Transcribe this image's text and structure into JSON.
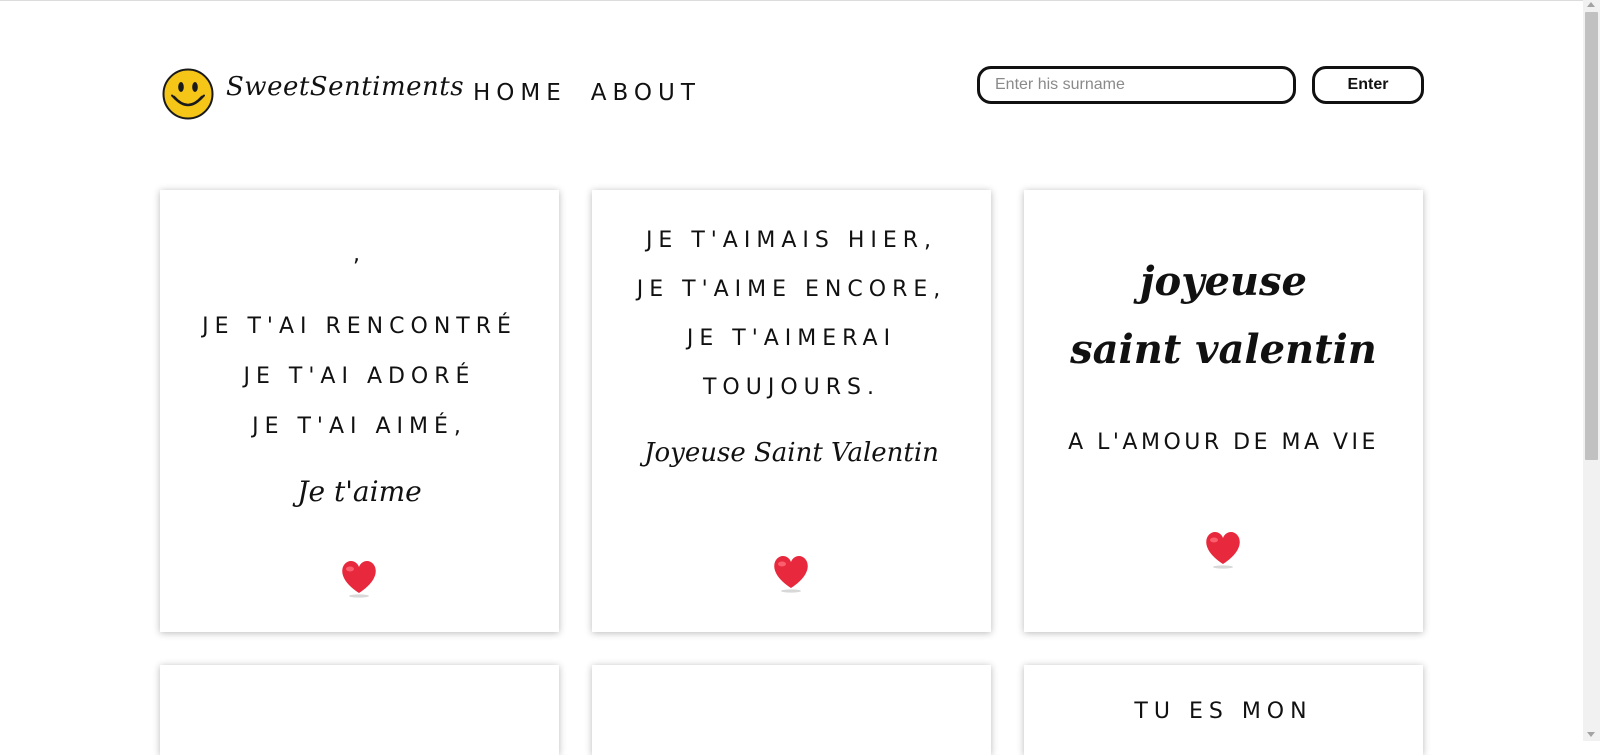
{
  "brand": {
    "name": "SweetSentiments",
    "logo_icon": "smiley-face-icon",
    "logo_color": "#f5c518"
  },
  "nav": {
    "items": [
      "HOME",
      "ABOUT"
    ]
  },
  "search": {
    "placeholder": "Enter his surname",
    "value": "",
    "button_label": "Enter"
  },
  "cards": [
    {
      "lines": [
        ",",
        "JE T'AI RENCONTRÉ",
        "JE T'AI ADORÉ",
        "JE T'AI AIMÉ,"
      ],
      "script": "Je t'aime",
      "icon": "heart-icon"
    },
    {
      "lines": [
        "JE T'AIMAIS HIER,",
        "JE T'AIME ENCORE,",
        "JE T'AIMERAI",
        "TOUJOURS."
      ],
      "script": "Joyeuse Saint Valentin",
      "icon": "heart-icon"
    },
    {
      "script_lines": [
        "joyeuse",
        "saint valentin"
      ],
      "lines": [
        "A L'AMOUR DE MA VIE"
      ],
      "icon": "heart-icon"
    },
    {
      "lines": []
    },
    {
      "lines": []
    },
    {
      "lines": [
        "TU ES MON"
      ]
    }
  ],
  "colors": {
    "heart": "#e8283c",
    "text": "#111111",
    "background": "#ffffff"
  }
}
